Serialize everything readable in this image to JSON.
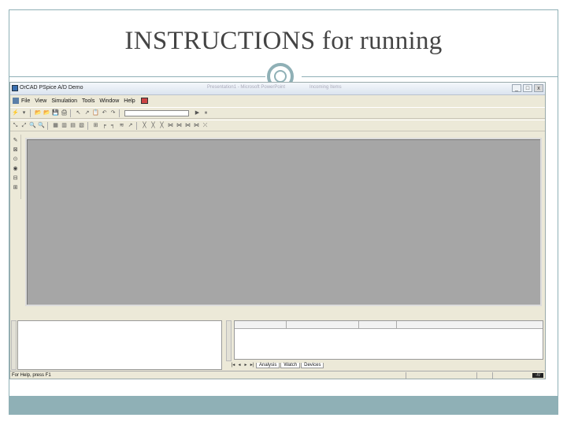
{
  "slide": {
    "title": "INSTRUCTIONS for running",
    "colors": {
      "accent": "#8fb0b6",
      "title_text": "#444444"
    }
  },
  "app": {
    "window_title": "OrCAD PSpice A/D Demo",
    "faded_titles": [
      "Presentation1 - Microsoft PowerPoint",
      "Incoming Items"
    ],
    "window_buttons": [
      "_",
      "□",
      "x"
    ],
    "menu": [
      "File",
      "View",
      "Simulation",
      "Tools",
      "Window",
      "Help"
    ],
    "toolbar1_left": [
      "⚡",
      "▾",
      "📂",
      "📂",
      "💾",
      "🖨",
      "↖",
      "↗",
      "📋",
      "↶",
      "↷"
    ],
    "toolbar1_right": [
      "▶",
      "⏸"
    ],
    "toolbar2": [
      "⤡",
      "⤢",
      "🔍",
      "🔍",
      "▦",
      "▥",
      "▤",
      "▧",
      "⊞",
      "╒",
      "╕",
      "≋",
      "↗",
      "╳",
      "╳",
      "╳",
      "⋈",
      "⋈",
      "⋈",
      "⋈",
      "⤫"
    ],
    "palette": [
      "✎",
      "⊠",
      "⊙",
      "◉",
      "⊟",
      "⊞"
    ],
    "workspace_color": "#a6a6a6",
    "output_tabs": [
      "Analysis",
      "Watch",
      "Devices"
    ],
    "tab_nav": [
      "|◂",
      "◂",
      "▸",
      "▸|"
    ],
    "status_text": "For Help, press F1",
    "status_graph_icon": "-/\\/"
  }
}
